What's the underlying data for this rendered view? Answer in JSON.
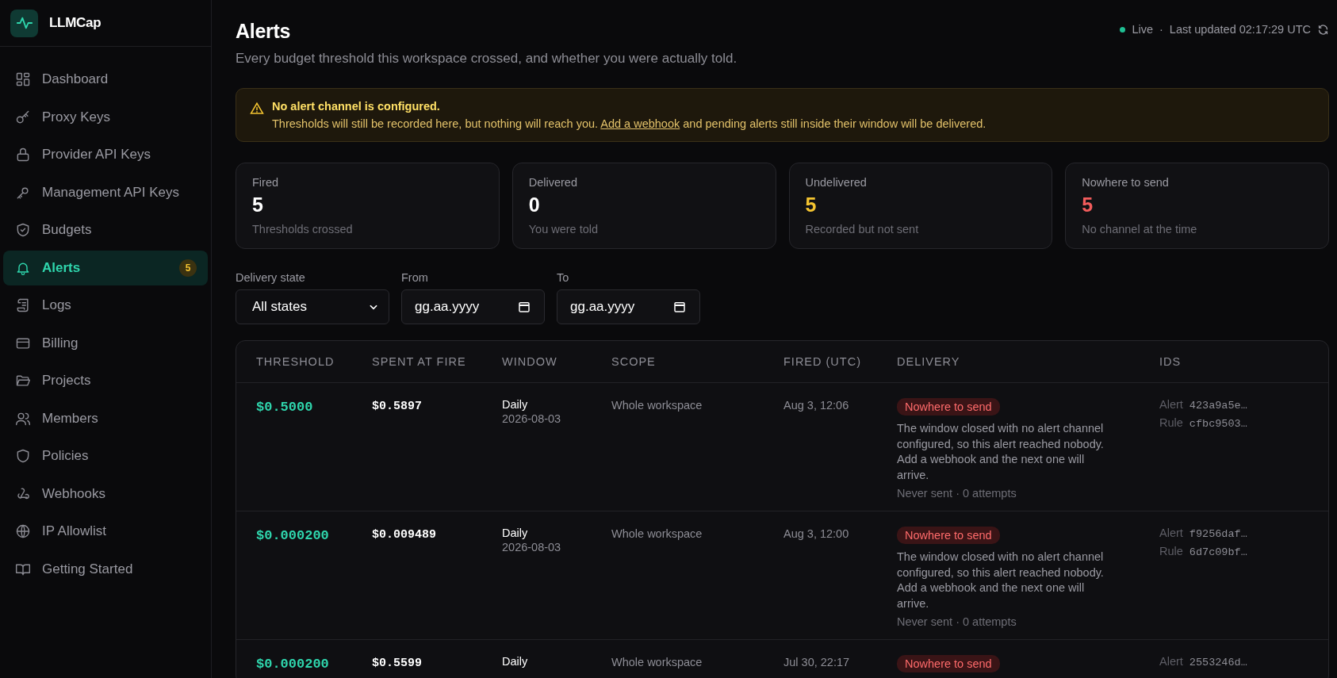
{
  "brand": {
    "name": "LLMCap"
  },
  "sidebar": {
    "items": [
      {
        "label": "Dashboard",
        "selected": false
      },
      {
        "label": "Proxy Keys",
        "selected": false
      },
      {
        "label": "Provider API Keys",
        "selected": false
      },
      {
        "label": "Management API Keys",
        "selected": false
      },
      {
        "label": "Budgets",
        "selected": false
      },
      {
        "label": "Alerts",
        "selected": true,
        "badge": "5"
      },
      {
        "label": "Logs",
        "selected": false
      },
      {
        "label": "Billing",
        "selected": false
      },
      {
        "label": "Projects",
        "selected": false
      },
      {
        "label": "Members",
        "selected": false
      },
      {
        "label": "Policies",
        "selected": false
      },
      {
        "label": "Webhooks",
        "selected": false
      },
      {
        "label": "IP Allowlist",
        "selected": false
      },
      {
        "label": "Getting Started",
        "selected": false
      }
    ]
  },
  "header": {
    "title": "Alerts",
    "subtitle": "Every budget threshold this workspace crossed, and whether you were actually told.",
    "status": {
      "label": "Live",
      "live": true
    },
    "separator": "·",
    "updated": "Last updated 02:17:29 UTC"
  },
  "banner": {
    "title": "No alert channel is configured.",
    "text_before": "Thresholds will still be recorded here, but nothing will reach you.",
    "link": "Add a webhook",
    "text_after": "and pending alerts still inside their window will be delivered."
  },
  "stats": [
    {
      "label": "Fired",
      "value": "5",
      "caption": "Thresholds crossed",
      "color": "#ffffff"
    },
    {
      "label": "Delivered",
      "value": "0",
      "caption": "You were told",
      "color": "#ffffff"
    },
    {
      "label": "Undelivered",
      "value": "5",
      "caption": "Recorded but not sent",
      "color": "#f4c430"
    },
    {
      "label": "Nowhere to send",
      "value": "5",
      "caption": "No channel at the time",
      "color": "#f25c5c"
    }
  ],
  "filters": [
    {
      "kind": "select",
      "label": "Delivery state",
      "value": "All states"
    },
    {
      "kind": "date",
      "label": "From",
      "placeholder": "gg.aa.yyyy"
    },
    {
      "kind": "date",
      "label": "To",
      "placeholder": "gg.aa.yyyy"
    }
  ],
  "table": {
    "columns": [
      "THRESHOLD",
      "SPENT AT FIRE",
      "WINDOW",
      "SCOPE",
      "FIRED (UTC)",
      "DELIVERY",
      "IDS"
    ],
    "rows": [
      {
        "threshold": "$0.5000",
        "spent": "$0.5897",
        "window": "Daily",
        "window_date": "2026-08-03",
        "scope": "Whole workspace",
        "fired": "Aug 3, 12:06",
        "delivery": {
          "kind": "nowhere",
          "status": "Nowhere to send",
          "note": "The window closed with no alert channel configured, so this alert reached nobody. Add a webhook and the next one will arrive.",
          "meta": "Never sent · 0 attempts"
        },
        "ids": [
          {
            "label": "Alert",
            "value": "423a9a5e…"
          },
          {
            "label": "Rule",
            "value": "cfbc9503…"
          }
        ]
      },
      {
        "threshold": "$0.000200",
        "spent": "$0.009489",
        "window": "Daily",
        "window_date": "2026-08-03",
        "scope": "Whole workspace",
        "fired": "Aug 3, 12:00",
        "delivery": {
          "kind": "nowhere",
          "status": "Nowhere to send",
          "note": "The window closed with no alert channel configured, so this alert reached nobody. Add a webhook and the next one will arrive.",
          "meta": "Never sent · 0 attempts"
        },
        "ids": [
          {
            "label": "Alert",
            "value": "f9256daf…"
          },
          {
            "label": "Rule",
            "value": "6d7c09bf…"
          }
        ]
      },
      {
        "threshold": "$0.000200",
        "spent": "$0.5599",
        "window": "Daily",
        "scope": "Whole workspace",
        "fired": "Jul 30, 22:17",
        "delivery": {
          "kind": "nowhere",
          "status": "Nowhere to send"
        },
        "ids": [
          {
            "label": "Alert",
            "value": "2553246d…"
          }
        ]
      }
    ]
  }
}
